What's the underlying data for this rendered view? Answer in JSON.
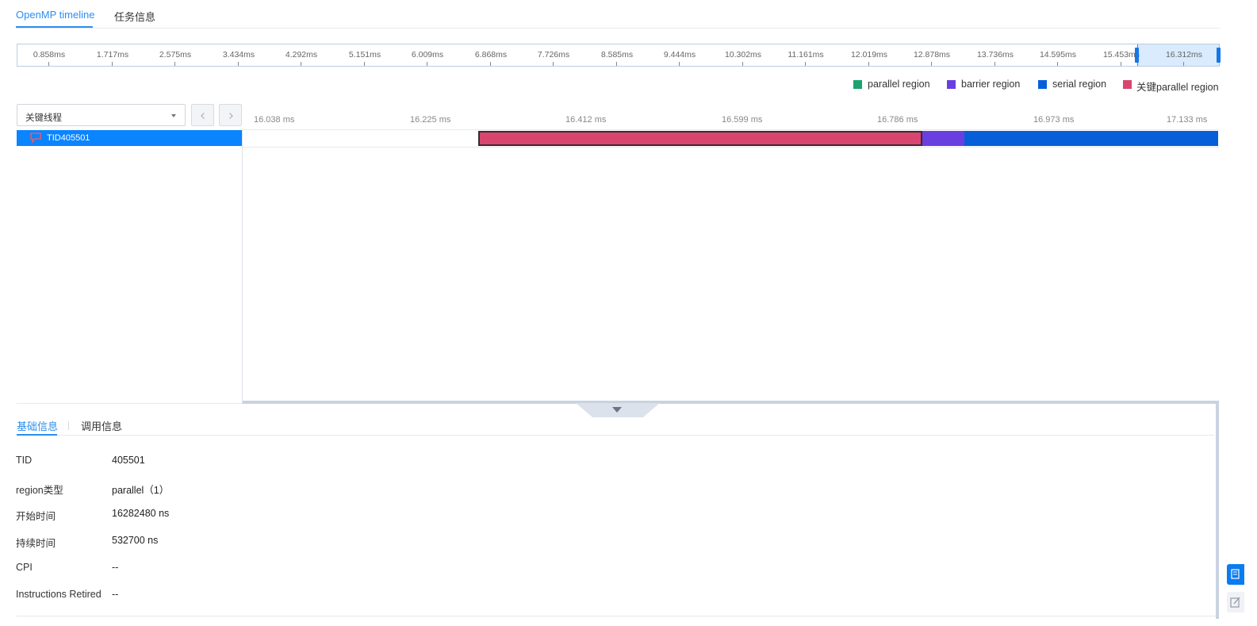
{
  "top_tabs": [
    {
      "label": "OpenMP timeline",
      "active": true
    },
    {
      "label": "任务信息",
      "active": false
    }
  ],
  "overview_ticks": [
    "0.858ms",
    "1.717ms",
    "2.575ms",
    "3.434ms",
    "4.292ms",
    "5.151ms",
    "6.009ms",
    "6.868ms",
    "7.726ms",
    "8.585ms",
    "9.444ms",
    "10.302ms",
    "11.161ms",
    "12.019ms",
    "12.878ms",
    "13.736ms",
    "14.595ms",
    "15.453ms",
    "16.312ms"
  ],
  "legend": [
    {
      "label": "parallel region",
      "color": "#1aa36f"
    },
    {
      "label": "barrier region",
      "color": "#6a3fe0"
    },
    {
      "label": "serial region",
      "color": "#065fd8"
    },
    {
      "label": "关键parallel region",
      "color": "#d8466f"
    }
  ],
  "thread_select": {
    "value": "关键线程"
  },
  "time_axis": [
    "16.038 ms",
    "16.225 ms",
    "16.412 ms",
    "16.599 ms",
    "16.786 ms",
    "16.973 ms",
    "17.133 ms"
  ],
  "thread": {
    "label": "TID405501"
  },
  "bottom_tabs": [
    {
      "label": "基础信息",
      "active": true
    },
    {
      "label": "调用信息",
      "active": false
    }
  ],
  "info": [
    {
      "key": "TID",
      "value": "405501"
    },
    {
      "key": "region类型",
      "value": "parallel（1）"
    },
    {
      "key": "开始时间",
      "value": "16282480 ns"
    },
    {
      "key": "持续时间",
      "value": "532700 ns"
    },
    {
      "key": "CPI",
      "value": "--"
    },
    {
      "key": "Instructions Retired",
      "value": "--"
    }
  ]
}
